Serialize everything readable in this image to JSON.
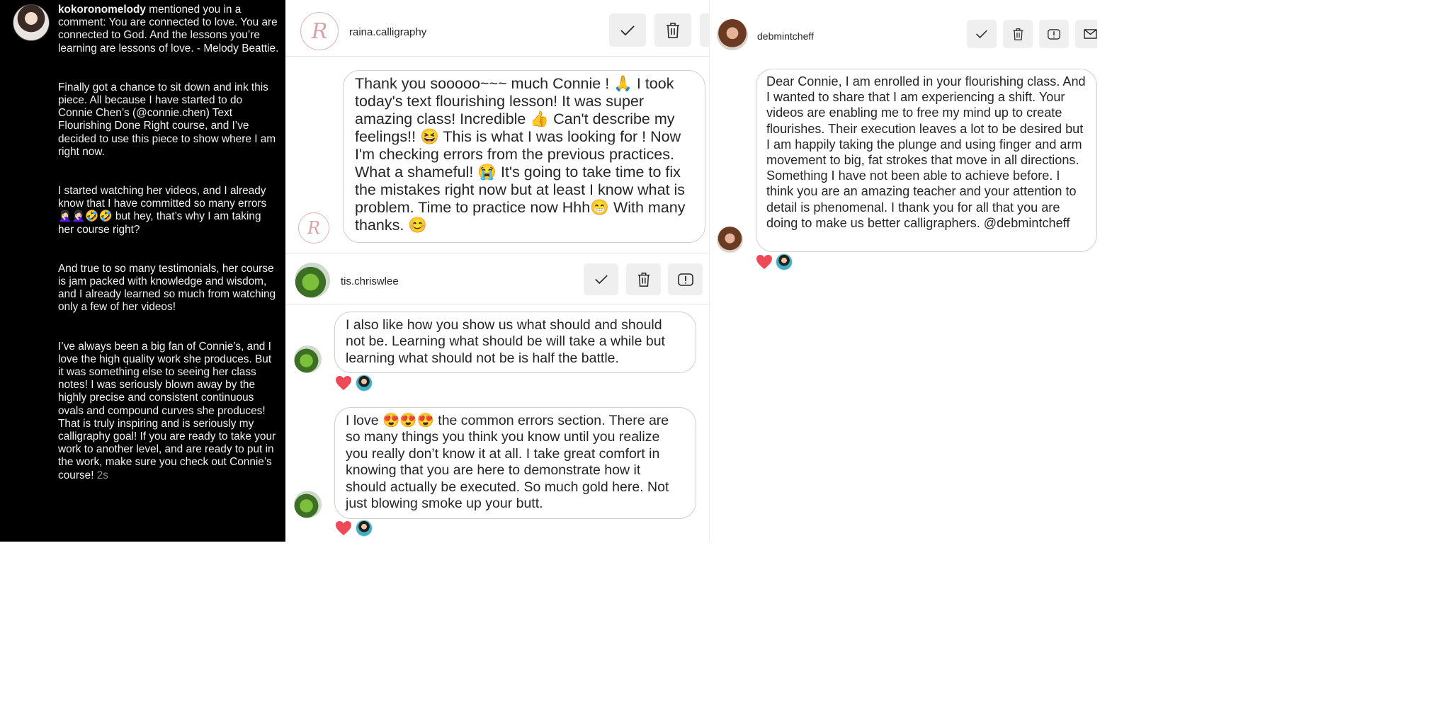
{
  "left_panel": {
    "username": "kokoronomelody",
    "mention_text": " mentioned you in a comment: You are connected to love. You are connected to God. And the lessons you’re learning are lessons of love. - Melody Beattie.",
    "paragraphs": [
      "Finally got a chance to sit down and ink this piece. All because I have started to do Connie Chen’s (@connie.chen) Text Flourishing Done Right course, and I’ve decided to use this piece to show where I am right now.",
      "I started watching her videos, and I already know that I have committed so many errors 🤦🏻‍♀️🤦🏻‍♀️🤣🤣 but hey, that’s why I am taking her course right?",
      "And true to so many testimonials, her course is jam packed with knowledge and wisdom, and I already learned so much from watching only a few of her videos!",
      "I’ve always been a big fan of Connie’s, and I love the high quality work she produces. But it was something else to seeing her class notes! I was seriously blown away by the highly precise and consistent continuous ovals and compound curves she produces! That is truly inspiring and is seriously my calligraphy goal! If you are ready to take your work to another level, and are ready to put in the work, make sure you check out Connie’s course! "
    ],
    "time": "2s"
  },
  "raina": {
    "username": "raina.calligraphy",
    "monogram": "R",
    "comment": "Thank you sooooo~~~ much Connie ! 🙏 I took today's text flourishing lesson!  It was super amazing class!  Incredible 👍 Can't describe my feelings!! 😆 This is what I was looking for !  Now I'm checking errors from the previous practices. What a shameful! 😭 It's going to take time to fix the mistakes right now but at least I know what is problem. Time to practice now Hhh😁 With many thanks. 😊"
  },
  "tis": {
    "username": "tis.chriswlee",
    "comments": [
      "I also like how you show us what should and should not be. Learning what should be will take a while but learning what should not be is half the battle.",
      "I love 😍😍😍 the common errors section. There are so many things you think you know until you realize you really don’t know it at all. I take great comfort in knowing that you are here to demonstrate how it should actually be executed. So much gold here. Not just blowing smoke up your butt."
    ]
  },
  "deb": {
    "username": "debmintcheff",
    "comment": "Dear Connie, I am enrolled in your flourishing class. And I wanted to share that I am experiencing a shift. Your videos are enabling me to free my mind up to create flourishes. Their execution leaves a lot to be desired but I am happily taking the plunge and using finger and arm movement to big, fat strokes that move in all directions. Something I have not been able to achieve before. I think you are an amazing teacher and your attention to detail is phenomenal. I thank you for all that you are doing to make us better calligraphers. @debmintcheff"
  },
  "colors": {
    "left_bg": "#000000",
    "heart": "#ed4956",
    "button_bg": "#efefef",
    "icon": "#262626"
  },
  "icons": [
    "approve-check-icon",
    "delete-trash-icon",
    "report-exclamation-icon",
    "message-envelope-icon",
    "like-heart-icon"
  ]
}
